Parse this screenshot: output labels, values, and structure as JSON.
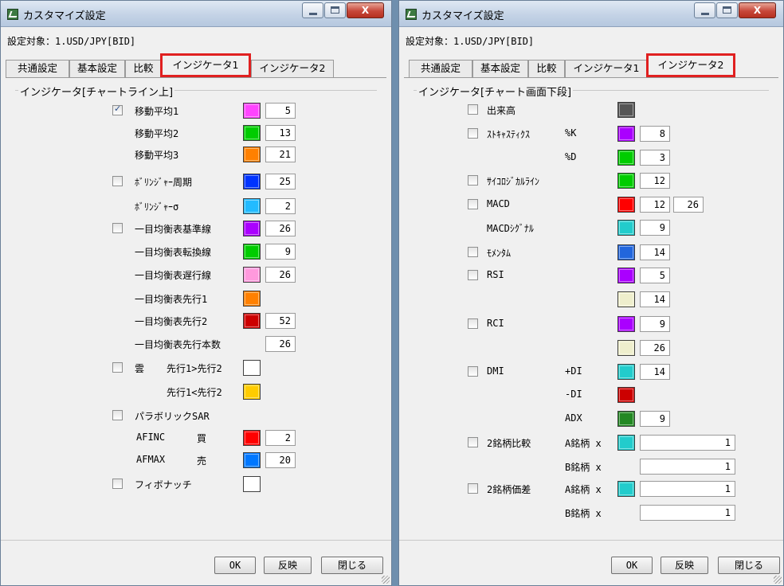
{
  "colors": {
    "magenta": "#ff44ff",
    "green": "#00cc00",
    "orange": "#ff8000",
    "blue": "#0033ff",
    "cyan": "#22bbff",
    "purple": "#aa00ff",
    "pink": "#ff99dd",
    "darkred": "#cc0000",
    "white": "#ffffff",
    "yellow": "#ffcc00",
    "red": "#ff0000",
    "sky": "#0077ff",
    "gray": "#555555",
    "teal": "#22cccc",
    "blue2": "#2266dd",
    "cream": "#eeeecc",
    "darkgreen": "#228822"
  },
  "window1": {
    "title": "カスタマイズ設定",
    "close_label": "X",
    "target": "設定対象：1.USD/JPY[BID]",
    "tabs": [
      {
        "label": "共通設定"
      },
      {
        "label": "基本設定"
      },
      {
        "label": "比較"
      },
      {
        "label": "インジケータ1"
      },
      {
        "label": "インジケータ2"
      }
    ],
    "group_title": "インジケータ[チャートライン上]",
    "rows": [
      {
        "checkbox": true,
        "checked": true,
        "label": "移動平均1",
        "color": "magenta",
        "value": "5"
      },
      {
        "checkbox": false,
        "label": "移動平均2",
        "color": "green",
        "value": "13"
      },
      {
        "checkbox": false,
        "label": "移動平均3",
        "color": "orange",
        "value": "21"
      },
      {
        "checkbox": true,
        "checked": false,
        "label": "ﾎﾞﾘﾝｼﾞｬｰ周期",
        "color": "blue",
        "value": "25"
      },
      {
        "checkbox": false,
        "label": "ﾎﾞﾘﾝｼﾞｬｰσ",
        "color": "cyan",
        "value": "2"
      },
      {
        "checkbox": true,
        "checked": false,
        "label": "一目均衡表基準線",
        "color": "purple",
        "value": "26"
      },
      {
        "checkbox": false,
        "label": "一目均衡表転換線",
        "color": "green",
        "value": "9"
      },
      {
        "checkbox": false,
        "label": "一目均衡表遅行線",
        "color": "pink",
        "value": "26"
      },
      {
        "checkbox": false,
        "label": "一目均衡表先行1",
        "color": "orange",
        "value": ""
      },
      {
        "checkbox": false,
        "label": "一目均衡表先行2",
        "color": "darkred",
        "value": "52"
      },
      {
        "checkbox": false,
        "label": "一目均衡表先行本数",
        "color": "",
        "value": "26"
      },
      {
        "checkbox": true,
        "checked": false,
        "label": "雲",
        "sub": "先行1>先行2",
        "color": "white",
        "value": ""
      },
      {
        "checkbox": false,
        "label": "",
        "sub": "先行1<先行2",
        "color": "yellow",
        "value": ""
      },
      {
        "checkbox": true,
        "checked": false,
        "label": "パラボリックSAR",
        "color": "",
        "value": ""
      },
      {
        "checkbox": false,
        "label": "AFINC",
        "sub": "買",
        "color": "red",
        "value": "2"
      },
      {
        "checkbox": false,
        "label": "AFMAX",
        "sub": "売",
        "color": "sky",
        "value": "20"
      },
      {
        "checkbox": true,
        "checked": false,
        "label": "フィボナッチ",
        "color": "white",
        "value": ""
      }
    ],
    "buttons": {
      "ok": "OK",
      "apply": "反映",
      "close": "閉じる"
    }
  },
  "window2": {
    "title": "カスタマイズ設定",
    "close_label": "X",
    "target": "設定対象：1.USD/JPY[BID]",
    "tabs": [
      {
        "label": "共通設定"
      },
      {
        "label": "基本設定"
      },
      {
        "label": "比較"
      },
      {
        "label": "インジケータ1"
      },
      {
        "label": "インジケータ2"
      }
    ],
    "group_title": "インジケータ[チャート画面下段]",
    "rows": [
      {
        "checkbox": true,
        "label": "出来高",
        "param": "",
        "color": "gray",
        "value": "",
        "value2": ""
      },
      {
        "checkbox": true,
        "label": "ｽﾄｷｬｽﾃｨｸｽ",
        "param": "%K",
        "color": "purple",
        "value": "8",
        "value2": ""
      },
      {
        "checkbox": false,
        "label": "",
        "param": "%D",
        "color": "green",
        "value": "3",
        "value2": ""
      },
      {
        "checkbox": true,
        "label": "ｻｲｺﾛｼﾞｶﾙﾗｲﾝ",
        "param": "",
        "color": "green",
        "value": "12",
        "value2": ""
      },
      {
        "checkbox": true,
        "label": "MACD",
        "param": "",
        "color": "red",
        "value": "12",
        "value2": "26"
      },
      {
        "checkbox": false,
        "label": "MACDｼｸﾞﾅﾙ",
        "param": "",
        "color": "teal",
        "value": "9",
        "value2": ""
      },
      {
        "checkbox": true,
        "label": "ﾓﾒﾝﾀﾑ",
        "param": "",
        "color": "blue2",
        "value": "14",
        "value2": ""
      },
      {
        "checkbox": true,
        "label": "RSI",
        "param": "",
        "color": "purple",
        "value": "5",
        "value2": ""
      },
      {
        "checkbox": false,
        "label": "",
        "param": "",
        "color": "cream",
        "value": "14",
        "value2": ""
      },
      {
        "checkbox": true,
        "label": "RCI",
        "param": "",
        "color": "purple",
        "value": "9",
        "value2": ""
      },
      {
        "checkbox": false,
        "label": "",
        "param": "",
        "color": "cream",
        "value": "26",
        "value2": ""
      },
      {
        "checkbox": true,
        "label": "DMI",
        "param": "+DI",
        "color": "teal",
        "value": "14",
        "value2": ""
      },
      {
        "checkbox": false,
        "label": "",
        "param": "-DI",
        "color": "darkred",
        "value": "",
        "value2": ""
      },
      {
        "checkbox": false,
        "label": "",
        "param": "ADX",
        "color": "darkgreen",
        "value": "9",
        "value2": ""
      },
      {
        "checkbox": true,
        "label": "2銘柄比較",
        "param": "A銘柄 x",
        "color": "teal",
        "wide": "1"
      },
      {
        "checkbox": false,
        "label": "",
        "param": "B銘柄 x",
        "color": "",
        "wide": "1"
      },
      {
        "checkbox": true,
        "label": "2銘柄価差",
        "param": "A銘柄 x",
        "color": "teal",
        "wide": "1"
      },
      {
        "checkbox": false,
        "label": "",
        "param": "B銘柄 x",
        "color": "",
        "wide": "1"
      }
    ],
    "buttons": {
      "ok": "OK",
      "apply": "反映",
      "close": "閉じる"
    }
  }
}
